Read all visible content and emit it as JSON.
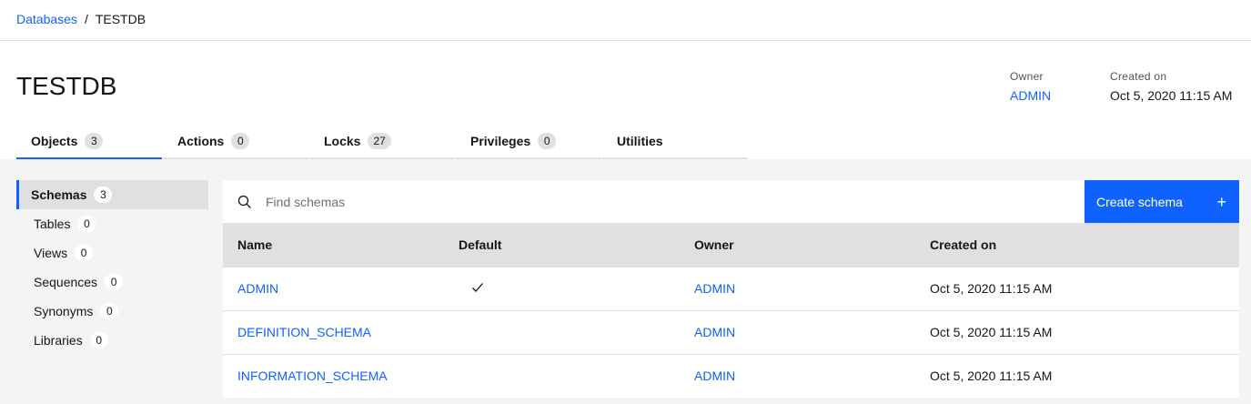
{
  "breadcrumb": {
    "parent": "Databases",
    "separator": "/",
    "current": "TESTDB"
  },
  "page": {
    "title": "TESTDB"
  },
  "meta": {
    "owner_label": "Owner",
    "owner_value": "ADMIN",
    "created_label": "Created on",
    "created_value": "Oct 5, 2020 11:15 AM"
  },
  "tabs": [
    {
      "label": "Objects",
      "count": "3",
      "active": true
    },
    {
      "label": "Actions",
      "count": "0"
    },
    {
      "label": "Locks",
      "count": "27"
    },
    {
      "label": "Privileges",
      "count": "0"
    },
    {
      "label": "Utilities"
    }
  ],
  "sidebar": {
    "items": [
      {
        "label": "Schemas",
        "count": "3",
        "active": true
      },
      {
        "label": "Tables",
        "count": "0"
      },
      {
        "label": "Views",
        "count": "0"
      },
      {
        "label": "Sequences",
        "count": "0"
      },
      {
        "label": "Synonyms",
        "count": "0"
      },
      {
        "label": "Libraries",
        "count": "0"
      }
    ]
  },
  "search": {
    "placeholder": "Find schemas",
    "value": ""
  },
  "toolbar": {
    "create_label": "Create schema",
    "create_icon": "+"
  },
  "table": {
    "headers": [
      "Name",
      "Default",
      "Owner",
      "Created on"
    ],
    "rows": [
      {
        "name": "ADMIN",
        "default": true,
        "owner": "ADMIN",
        "created": "Oct 5, 2020 11:15 AM"
      },
      {
        "name": "DEFINITION_SCHEMA",
        "default": false,
        "owner": "ADMIN",
        "created": "Oct 5, 2020 11:15 AM"
      },
      {
        "name": "INFORMATION_SCHEMA",
        "default": false,
        "owner": "ADMIN",
        "created": "Oct 5, 2020 11:15 AM"
      }
    ]
  },
  "colors": {
    "accent": "#0f62fe",
    "border": "#e0e0e0",
    "background": "#f4f4f4"
  }
}
